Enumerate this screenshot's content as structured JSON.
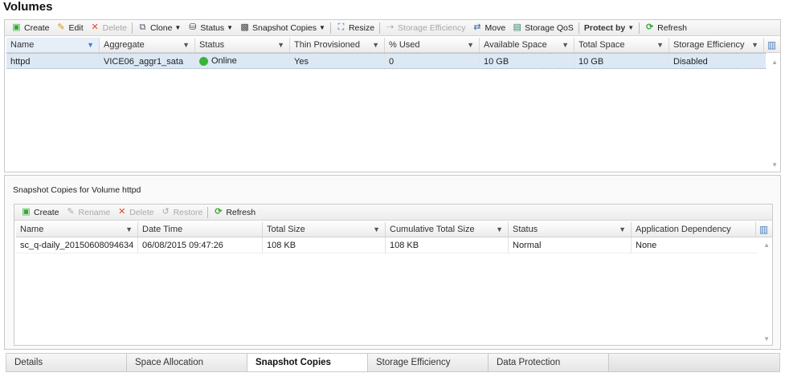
{
  "title": "Volumes",
  "toolbar": {
    "create": "Create",
    "edit": "Edit",
    "delete": "Delete",
    "clone": "Clone",
    "status": "Status",
    "snapshot_copies": "Snapshot Copies",
    "resize": "Resize",
    "storage_efficiency": "Storage Efficiency",
    "move": "Move",
    "storage_qos": "Storage QoS",
    "protect_by": "Protect by",
    "refresh": "Refresh"
  },
  "volumes": {
    "columns": [
      "Name",
      "Aggregate",
      "Status",
      "Thin Provisioned",
      "% Used",
      "Available Space",
      "Total Space",
      "Storage Efficiency"
    ],
    "rows": [
      {
        "name": "httpd",
        "aggregate": "VICE06_aggr1_sata",
        "status": "Online",
        "thin": "Yes",
        "used": "0",
        "available": "10 GB",
        "total": "10 GB",
        "efficiency": "Disabled"
      }
    ]
  },
  "snapshots": {
    "heading": "Snapshot Copies for Volume httpd",
    "toolbar": {
      "create": "Create",
      "rename": "Rename",
      "delete": "Delete",
      "restore": "Restore",
      "refresh": "Refresh"
    },
    "columns": [
      "Name",
      "Date Time",
      "Total Size",
      "Cumulative Total Size",
      "Status",
      "Application Dependency"
    ],
    "rows": [
      {
        "name": "sc_q-daily_20150608094634",
        "datetime": "06/08/2015 09:47:26",
        "total": "108 KB",
        "cumulative": "108 KB",
        "status": "Normal",
        "dependency": "None"
      }
    ]
  },
  "tabs": [
    "Details",
    "Space Allocation",
    "Snapshot Copies",
    "Storage Efficiency",
    "Data Protection"
  ],
  "colors": {
    "online": "#3bb33b",
    "selected_row": "#dde8f5",
    "delete": "#e0442a",
    "refresh": "#3aa83a"
  }
}
